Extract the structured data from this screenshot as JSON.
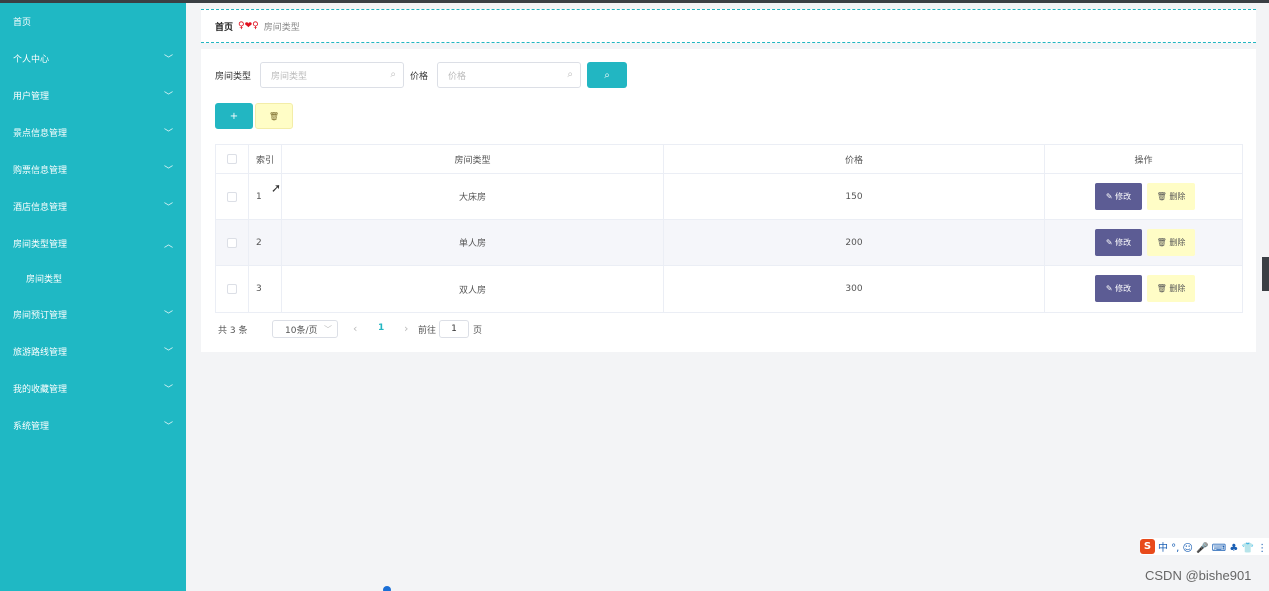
{
  "sidebar": {
    "items": [
      {
        "label": "首页",
        "has_chevron": false
      },
      {
        "label": "个人中心",
        "has_chevron": true,
        "chevron": "﹀"
      },
      {
        "label": "用户管理",
        "has_chevron": true,
        "chevron": "﹀"
      },
      {
        "label": "景点信息管理",
        "has_chevron": true,
        "chevron": "﹀"
      },
      {
        "label": "购票信息管理",
        "has_chevron": true,
        "chevron": "﹀"
      },
      {
        "label": "酒店信息管理",
        "has_chevron": true,
        "chevron": "﹀"
      },
      {
        "label": "房间类型管理",
        "has_chevron": true,
        "chevron": "︿"
      },
      {
        "label": "房间类型",
        "has_chevron": false
      },
      {
        "label": "房间预订管理",
        "has_chevron": true,
        "chevron": "﹀"
      },
      {
        "label": "旅游路线管理",
        "has_chevron": true,
        "chevron": "﹀"
      },
      {
        "label": "我的收藏管理",
        "has_chevron": true,
        "chevron": "﹀"
      },
      {
        "label": "系统管理",
        "has_chevron": true,
        "chevron": "﹀"
      }
    ]
  },
  "breadcrumb": {
    "home": "首页",
    "separator": "♀❤♀",
    "current": "房间类型"
  },
  "search": {
    "type_label": "房间类型",
    "type_placeholder": "房间类型",
    "price_label": "价格",
    "price_placeholder": "价格",
    "search_icon": "⌕"
  },
  "toolbar": {
    "add_label": "+",
    "delete_icon": "🗑"
  },
  "table": {
    "headers": {
      "index": "索引",
      "room_type": "房间类型",
      "price": "价格",
      "actions": "操作"
    },
    "rows": [
      {
        "index": "1",
        "room_type": "大床房",
        "price": "150"
      },
      {
        "index": "2",
        "room_type": "单人房",
        "price": "200"
      },
      {
        "index": "3",
        "room_type": "双人房",
        "price": "300"
      }
    ],
    "edit_label": "✎ 修改",
    "delete_label": "🗑 删除"
  },
  "pagination": {
    "total": "共 3 条",
    "page_size": "10条/页",
    "prev": "‹",
    "current_page": "1",
    "next": "›",
    "goto_label": "前往",
    "goto_value": "1",
    "page_suffix": "页"
  },
  "ime": {
    "logo": "S",
    "text": "中 °, ☺ 🎤 ⌨ ♣ 👕 ⋮"
  },
  "watermark": "CSDN @bishe901",
  "colors": {
    "sidebar": "#1fb8c4",
    "accent": "#22b6c2",
    "edit_button": "#5c5c94",
    "delete_button": "#fffdc6",
    "breadcrumb_sep": "#e0101f"
  }
}
